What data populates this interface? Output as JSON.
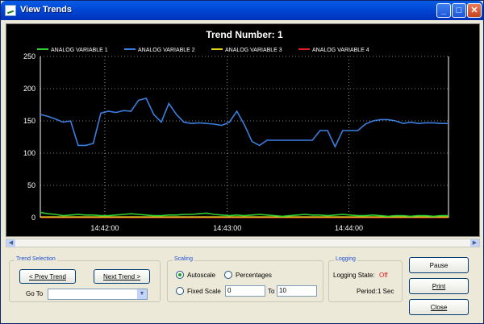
{
  "window": {
    "title": "View Trends"
  },
  "chart_data": {
    "type": "line",
    "title": "Trend Number: 1",
    "x_ticks": [
      "14:42:00",
      "14:43:00",
      "14:44:00"
    ],
    "y_ticks": [
      0,
      50,
      100,
      150,
      200,
      250
    ],
    "ylim": [
      0,
      250
    ],
    "grid": true,
    "legend_position": "top",
    "series": [
      {
        "name": "ANALOG VARIABLE 1",
        "color": "#2fd02f",
        "values": [
          8,
          6,
          5,
          3,
          4,
          5,
          4,
          4,
          3,
          3,
          4,
          5,
          6,
          5,
          4,
          3,
          3,
          4,
          4,
          5,
          5,
          6,
          7,
          5,
          4,
          3,
          4,
          3,
          4,
          5,
          4,
          3,
          2,
          3,
          4,
          5,
          4,
          4,
          3,
          4,
          5,
          4,
          3,
          3,
          4,
          3,
          2,
          3,
          3,
          2,
          3,
          3,
          2,
          3,
          3
        ]
      },
      {
        "name": "ANALOG VARIABLE 2",
        "color": "#3a7fe0",
        "values": [
          160,
          157,
          153,
          148,
          150,
          112,
          112,
          115,
          162,
          165,
          163,
          166,
          165,
          182,
          185,
          160,
          148,
          177,
          160,
          148,
          146,
          147,
          146,
          145,
          143,
          148,
          165,
          144,
          118,
          112,
          120,
          120,
          120,
          120,
          120,
          120,
          120,
          135,
          135,
          110,
          135,
          135,
          135,
          145,
          150,
          152,
          152,
          150,
          146,
          148,
          146,
          147,
          147,
          146,
          146
        ]
      },
      {
        "name": "ANALOG VARIABLE 3",
        "color": "#e0d020",
        "values": [
          1,
          1,
          1,
          1,
          1,
          1,
          1,
          1,
          1,
          1,
          1,
          1,
          1,
          1,
          1,
          1,
          1,
          1,
          1,
          1,
          1,
          1,
          1,
          1,
          1,
          1,
          1,
          1,
          1,
          1,
          1,
          1,
          1,
          1,
          1,
          1,
          1,
          1,
          1,
          1,
          1,
          1,
          1,
          1,
          1,
          1,
          1,
          1,
          1,
          1,
          1,
          1,
          1,
          1,
          1
        ]
      },
      {
        "name": "ANALOG VARIABLE 4",
        "color": "#e02020",
        "values": [
          0,
          0,
          0,
          0,
          0,
          0,
          0,
          0,
          0,
          0,
          0,
          0,
          0,
          0,
          0,
          0,
          0,
          0,
          0,
          0,
          0,
          0,
          0,
          0,
          0,
          0,
          0,
          0,
          0,
          0,
          0,
          0,
          0,
          0,
          0,
          0,
          0,
          0,
          0,
          0,
          0,
          0,
          0,
          0,
          0,
          0,
          0,
          0,
          0,
          0,
          0,
          0,
          0,
          0,
          0
        ]
      }
    ]
  },
  "trend_selection": {
    "label": "Trend Selection",
    "prev_label": "< Prev Trend",
    "next_label": "Next Trend >",
    "goto_label": "Go To",
    "goto_value": ""
  },
  "scaling": {
    "label": "Scaling",
    "autoscale_label": "Autoscale",
    "percentages_label": "Percentages",
    "fixed_label": "Fixed Scale",
    "from_value": "0",
    "to_label": "To",
    "to_value": "10",
    "selected": "autoscale"
  },
  "logging": {
    "label": "Logging",
    "state_label": "Logging State:",
    "state_value": "Off",
    "state_color": "#e02020",
    "period_label": "Period:",
    "period_value": "1 Sec"
  },
  "actions": {
    "pause_label": "Pause",
    "print_label": "Print",
    "close_label": "Close"
  }
}
